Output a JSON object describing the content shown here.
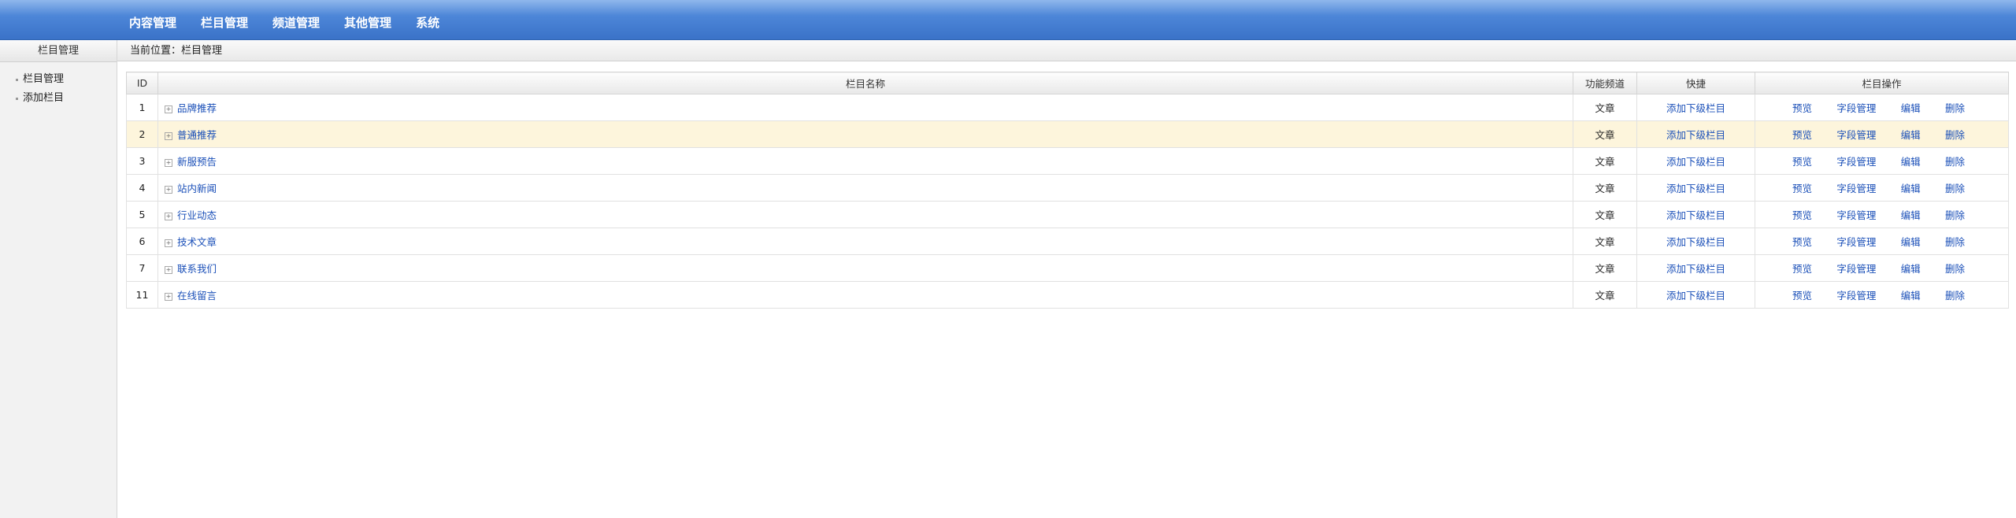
{
  "topnav": [
    "内容管理",
    "栏目管理",
    "频道管理",
    "其他管理",
    "系统"
  ],
  "sidebar": {
    "title": "栏目管理",
    "items": [
      "栏目管理",
      "添加栏目"
    ]
  },
  "breadcrumb": "当前位置：栏目管理",
  "table": {
    "headers": {
      "id": "ID",
      "name": "栏目名称",
      "channel": "功能频道",
      "shortcut": "快捷",
      "ops": "栏目操作"
    },
    "rows": [
      {
        "id": "1",
        "name": "品牌推荐",
        "channel": "文章",
        "shortcut": "添加下级栏目"
      },
      {
        "id": "2",
        "name": "普通推荐",
        "channel": "文章",
        "shortcut": "添加下级栏目"
      },
      {
        "id": "3",
        "name": "新服预告",
        "channel": "文章",
        "shortcut": "添加下级栏目"
      },
      {
        "id": "4",
        "name": "站内新闻",
        "channel": "文章",
        "shortcut": "添加下级栏目"
      },
      {
        "id": "5",
        "name": "行业动态",
        "channel": "文章",
        "shortcut": "添加下级栏目"
      },
      {
        "id": "6",
        "name": "技术文章",
        "channel": "文章",
        "shortcut": "添加下级栏目"
      },
      {
        "id": "7",
        "name": "联系我们",
        "channel": "文章",
        "shortcut": "添加下级栏目"
      },
      {
        "id": "11",
        "name": "在线留言",
        "channel": "文章",
        "shortcut": "添加下级栏目"
      }
    ],
    "row_ops": [
      "预览",
      "字段管理",
      "编辑",
      "删除"
    ],
    "highlighted_row": 1
  },
  "colors": {
    "topbar": "#4d86d8",
    "link": "#1a4fb8",
    "highlight_row": "#fdf5dc"
  }
}
